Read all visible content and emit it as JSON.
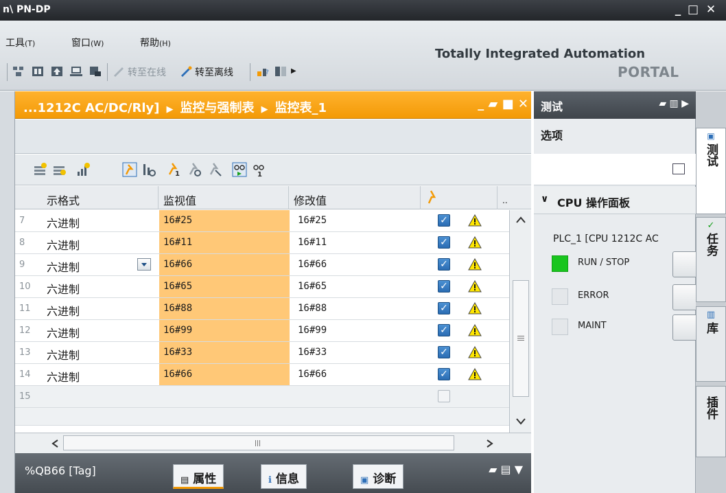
{
  "window": {
    "title": "n\\ PN-DP",
    "min": "_",
    "max": "□",
    "close": "✕"
  },
  "menu": [
    {
      "label": "工具",
      "mnemonic": "(T)"
    },
    {
      "label": "窗口",
      "mnemonic": "(W)"
    },
    {
      "label": "帮助",
      "mnemonic": "(H)"
    }
  ],
  "toolbar": {
    "go_online": "转至在线",
    "go_offline": "转至离线"
  },
  "branding": {
    "line1": "Totally Integrated Automation",
    "line2": "PORTAL"
  },
  "editor": {
    "breadcrumb": [
      "...1212C AC/DC/Rly]",
      "监控与强制表",
      "监控表_1"
    ],
    "breadcrumb_sep": "▶",
    "buttons": {
      "min": "_",
      "restore": "▰",
      "max": "■",
      "close": "✕"
    }
  },
  "table": {
    "headers": {
      "display_format": "示格式",
      "monitor_value": "监视值",
      "modify_value": "修改值",
      "more": ".."
    },
    "rows": [
      {
        "num": "7",
        "format": "六进制",
        "monitor": "16#25",
        "modify": "16#25",
        "checked": true,
        "warn": true
      },
      {
        "num": "8",
        "format": "六进制",
        "monitor": "16#11",
        "modify": "16#11",
        "checked": true,
        "warn": true
      },
      {
        "num": "9",
        "format": "六进制",
        "monitor": "16#66",
        "modify": "16#66",
        "checked": true,
        "warn": true,
        "dropdown": true
      },
      {
        "num": "10",
        "format": "六进制",
        "monitor": "16#65",
        "modify": "16#65",
        "checked": true,
        "warn": true
      },
      {
        "num": "11",
        "format": "六进制",
        "monitor": "16#88",
        "modify": "16#88",
        "checked": true,
        "warn": true
      },
      {
        "num": "12",
        "format": "六进制",
        "monitor": "16#99",
        "modify": "16#99",
        "checked": true,
        "warn": true
      },
      {
        "num": "13",
        "format": "六进制",
        "monitor": "16#33",
        "modify": "16#33",
        "checked": true,
        "warn": true
      },
      {
        "num": "14",
        "format": "六进制",
        "monitor": "16#66",
        "modify": "16#66",
        "checked": true,
        "warn": true
      },
      {
        "num": "15",
        "format": "",
        "monitor": "",
        "modify": "",
        "checked": false,
        "warn": false
      }
    ]
  },
  "properties": {
    "tag": "%QB66 [Tag]",
    "tabs": [
      "属性",
      "信息",
      "诊断"
    ]
  },
  "test_panel": {
    "title": "测试",
    "options_label": "选项",
    "cpu_panel_label": "CPU 操作面板",
    "plc_name": "PLC_1 [CPU 1212C AC",
    "leds": [
      {
        "label": "RUN / STOP",
        "on": true
      },
      {
        "label": "ERROR",
        "on": false
      },
      {
        "label": "MAINT",
        "on": false
      }
    ]
  },
  "side_tabs": [
    "测试",
    "任务",
    "库",
    "插件"
  ],
  "colors": {
    "accent": "#f39a06",
    "monitor_bg": "#ffc877",
    "led_green": "#19c51e"
  }
}
